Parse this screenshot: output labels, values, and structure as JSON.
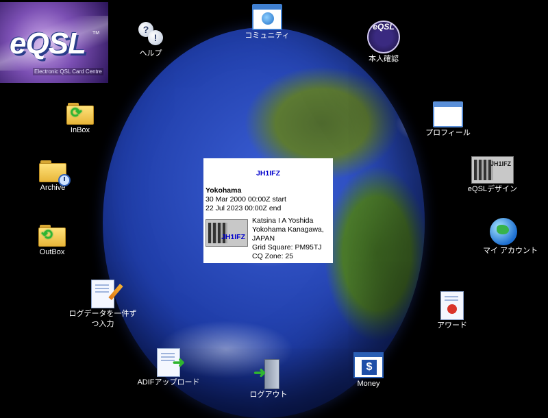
{
  "logo": {
    "main": "eQSL",
    "tm": "TM",
    "sub": "Electronic QSL Card Centre"
  },
  "nav": {
    "help": "ヘルプ",
    "community": "コミュニティ",
    "identity": "本人確認",
    "identity_seal_text": "eQSL",
    "profile": "プロフィール",
    "design": "eQSLデザイン",
    "design_card_callsign": "JH1IFZ",
    "account": "マイ アカウント",
    "award": "アワード",
    "money": "Money",
    "money_symbol": "$",
    "logout": "ログアウト",
    "adif_upload": "ADIFアップロード",
    "log_entry": "ログデータを一件ずつ入力",
    "outbox": "OutBox",
    "archive": "Archive",
    "inbox": "InBox"
  },
  "panel": {
    "callsign": "JH1IFZ",
    "qth_name": "Yokohama",
    "start": "30 Mar 2000 00:00Z start",
    "end": "22 Jul 2023 00:00Z end",
    "name": "Katsina I A Yoshida",
    "city": "Yokohama Kanagawa,",
    "country": "JAPAN",
    "grid": "Grid Square: PM95TJ",
    "cq_zone": "CQ Zone: 25",
    "card_callsign": "JH1IFZ"
  }
}
